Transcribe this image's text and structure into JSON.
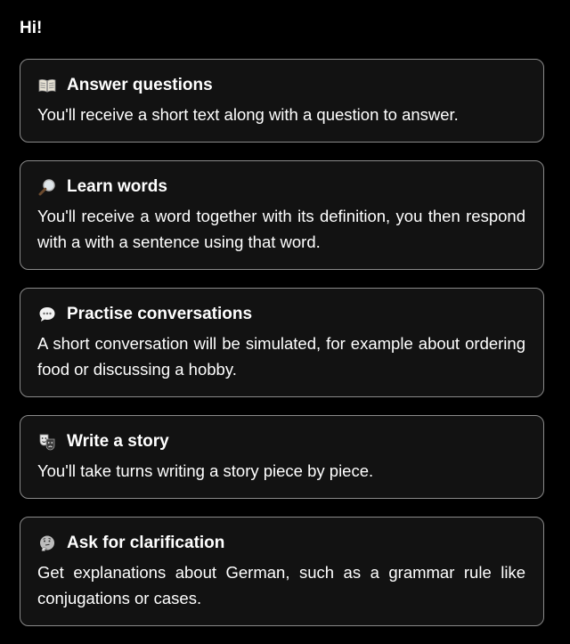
{
  "greeting": "Hi!",
  "options": [
    {
      "icon": "open-book-icon",
      "title": "Answer questions",
      "description": "You'll receive a short text along with a question to answer."
    },
    {
      "icon": "magnifying-glass-icon",
      "title": "Learn words",
      "description": "You'll receive a word together with its definition, you then respond with a with a sentence using that word."
    },
    {
      "icon": "speech-bubble-icon",
      "title": "Practise conversations",
      "description": "A short conversation will be simulated, for example about ordering food or discussing a hobby."
    },
    {
      "icon": "theater-masks-icon",
      "title": "Write a story",
      "description": "You'll take turns writing a story piece by piece."
    },
    {
      "icon": "thinking-face-icon",
      "title": "Ask for clarification",
      "description": "Get explanations about German, such as a grammar rule like conjugations or cases."
    }
  ],
  "colors": {
    "background": "#000000",
    "card_background": "#121212",
    "card_border": "#8a8a8a",
    "text": "#ffffff"
  }
}
